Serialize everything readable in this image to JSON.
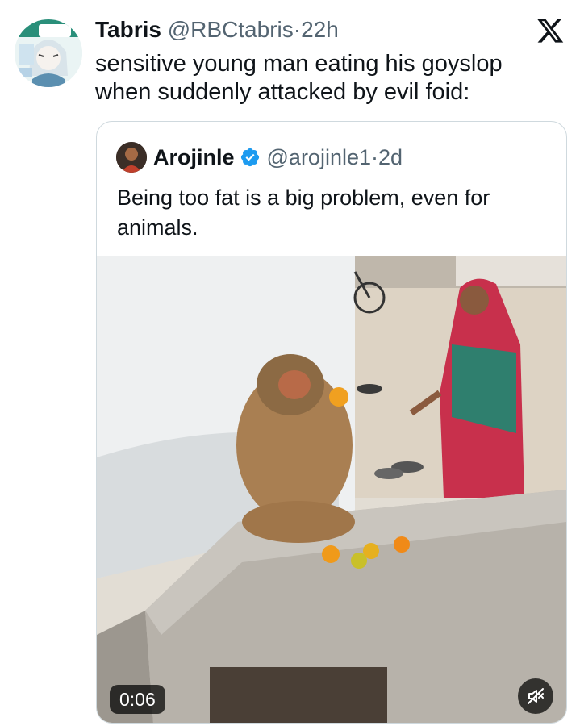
{
  "tweet": {
    "display_name": "Tabris",
    "handle": "@RBCtabris",
    "separator": "·",
    "time": "22h",
    "text": "sensitive young man eating his goyslop when suddenly attacked by evil foid:"
  },
  "quoted_tweet": {
    "display_name": "Arojinle",
    "handle": "@arojinle1",
    "separator": "·",
    "time": "2d",
    "verified": true,
    "text": "Being too fat is a big problem, even for animals.",
    "media": {
      "type": "video",
      "duration": "0:06",
      "muted": true
    }
  },
  "icons": {
    "brand": "x-logo-icon",
    "verified": "verified-badge-icon",
    "mute": "speaker-muted-icon"
  },
  "colors": {
    "text": "#0f1419",
    "muted": "#536471",
    "verified": "#1d9bf0",
    "border": "#cfd9de"
  }
}
